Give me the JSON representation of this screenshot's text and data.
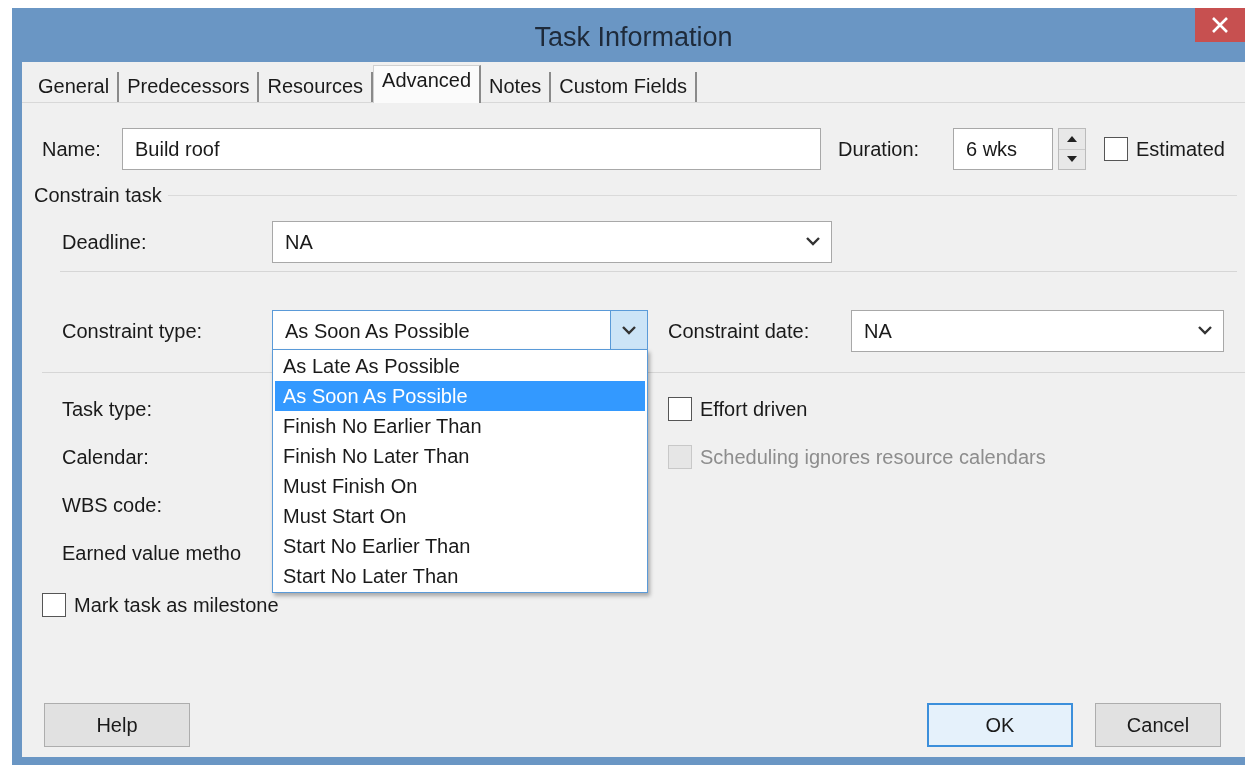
{
  "window": {
    "title": "Task Information"
  },
  "tabs": [
    {
      "label": "General",
      "selected": false
    },
    {
      "label": "Predecessors",
      "selected": false
    },
    {
      "label": "Resources",
      "selected": false
    },
    {
      "label": "Advanced",
      "selected": true
    },
    {
      "label": "Notes",
      "selected": false
    },
    {
      "label": "Custom Fields",
      "selected": false
    }
  ],
  "name": {
    "label": "Name:",
    "value": "Build roof"
  },
  "duration": {
    "label": "Duration:",
    "value": "6 wks"
  },
  "estimated": {
    "label": "Estimated",
    "checked": false,
    "disabled": false
  },
  "constrain_task": {
    "title": "Constrain task",
    "deadline": {
      "label": "Deadline:",
      "value": "NA"
    },
    "constraint_type": {
      "label": "Constraint type:",
      "value": "As Soon As Possible",
      "expanded": true,
      "options": [
        {
          "label": "As Late As Possible",
          "selected": false
        },
        {
          "label": "As Soon As Possible",
          "selected": true
        },
        {
          "label": "Finish No Earlier Than",
          "selected": false
        },
        {
          "label": "Finish No Later Than",
          "selected": false
        },
        {
          "label": "Must Finish On",
          "selected": false
        },
        {
          "label": "Must Start On",
          "selected": false
        },
        {
          "label": "Start No Earlier Than",
          "selected": false
        },
        {
          "label": "Start No Later Than",
          "selected": false
        }
      ]
    },
    "constraint_date": {
      "label": "Constraint date:",
      "value": "NA"
    }
  },
  "task_type": {
    "label": "Task type:"
  },
  "calendar": {
    "label": "Calendar:"
  },
  "wbs_code": {
    "label": "WBS code:"
  },
  "earned_value_method": {
    "label": "Earned value metho"
  },
  "effort_driven": {
    "label": "Effort driven",
    "checked": false,
    "disabled": false
  },
  "scheduling_ignores": {
    "label": "Scheduling ignores resource calendars",
    "checked": false,
    "disabled": true
  },
  "milestone": {
    "label": "Mark task as milestone",
    "checked": false,
    "disabled": false
  },
  "buttons": [
    {
      "label": "Help",
      "kind": "normal"
    },
    {
      "label": "OK",
      "kind": "default"
    },
    {
      "label": "Cancel",
      "kind": "normal"
    }
  ]
}
